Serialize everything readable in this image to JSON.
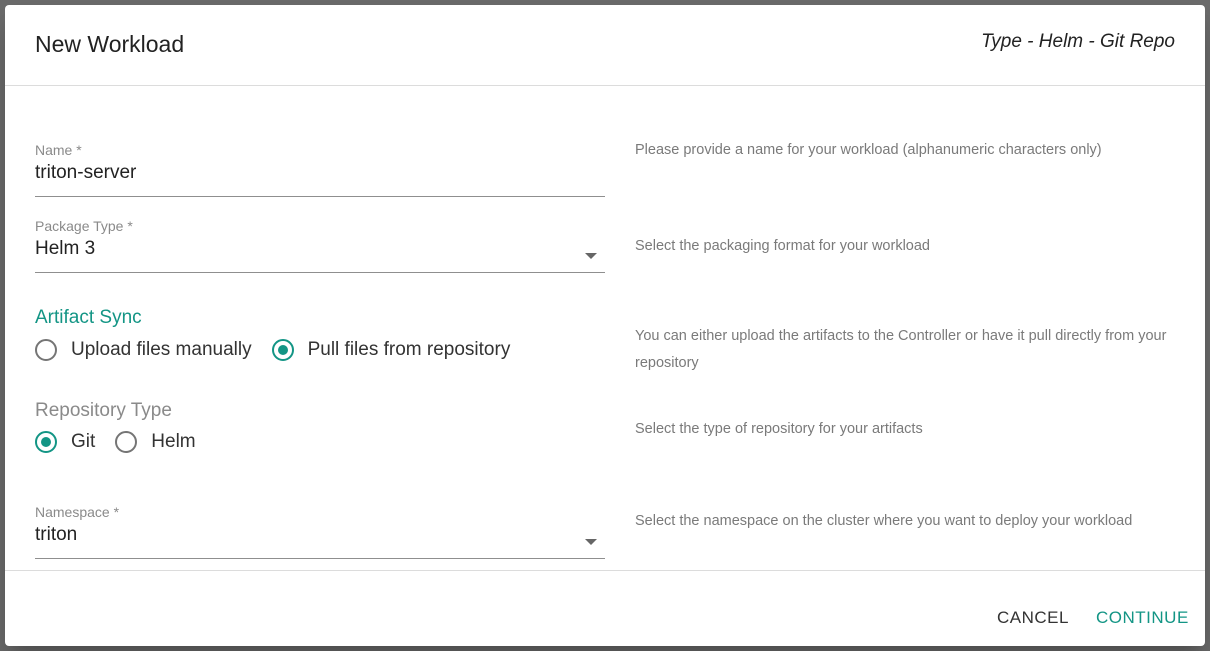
{
  "dialog": {
    "title": "New Workload",
    "subtitle": "Type - Helm - Git Repo"
  },
  "form": {
    "name": {
      "label": "Name *",
      "value": "triton-server",
      "help": "Please provide a name for your workload (alphanumeric characters only)"
    },
    "package_type": {
      "label": "Package Type *",
      "value": "Helm 3",
      "help": "Select the packaging format for your workload"
    },
    "artifact_sync": {
      "title": "Artifact Sync",
      "options": [
        {
          "label": "Upload files manually",
          "checked": false
        },
        {
          "label": "Pull files from repository",
          "checked": true
        }
      ],
      "help": "You can either upload the artifacts to the Controller or have it pull directly from your repository"
    },
    "repository_type": {
      "title": "Repository Type",
      "options": [
        {
          "label": "Git",
          "checked": true
        },
        {
          "label": "Helm",
          "checked": false
        }
      ],
      "help": "Select the type of repository for your artifacts"
    },
    "namespace": {
      "label": "Namespace *",
      "value": "triton",
      "help": "Select the namespace on the cluster where you want to deploy your workload"
    }
  },
  "footer": {
    "cancel_label": "CANCEL",
    "continue_label": "CONTINUE"
  },
  "colors": {
    "accent": "#139585",
    "overlay": "#6b6b6b"
  }
}
